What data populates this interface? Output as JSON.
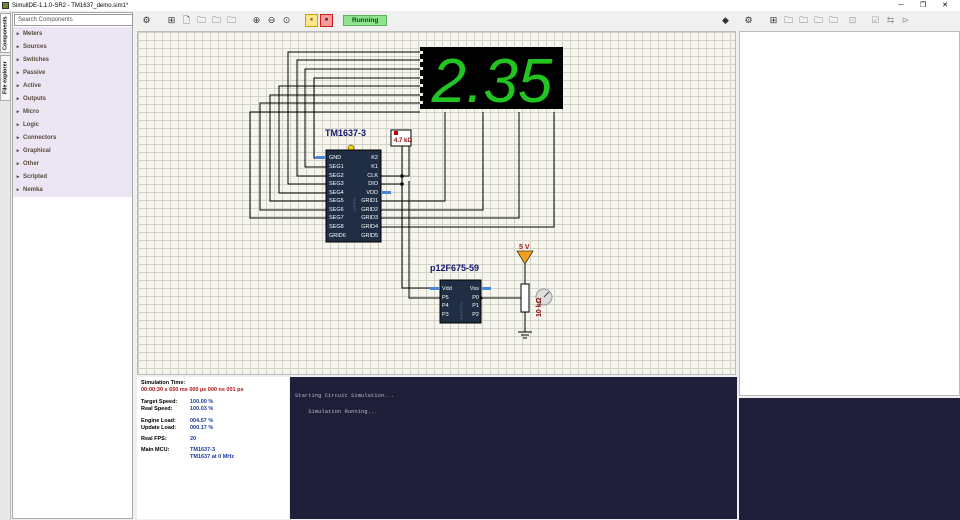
{
  "window": {
    "title": "SimulIDE-1.1.0-SR2 - TM1637_demo.sim1*",
    "minimize": "─",
    "restore": "❐",
    "close": "✕"
  },
  "side_tabs": {
    "components": "Components",
    "file_explorer": "File explorer"
  },
  "components_panel": {
    "search_placeholder": "Search Components",
    "categories": [
      "Meters",
      "Sources",
      "Switches",
      "Passive",
      "Active",
      "Outputs",
      "Micro",
      "Logic",
      "Connectors",
      "Graphical",
      "Other",
      "Scripted",
      "Nemka"
    ]
  },
  "toolbar": {
    "status": "Running"
  },
  "circuit": {
    "display_value": "2.35",
    "tm1637": {
      "label": "TM1637-3",
      "left_pins": [
        "GND",
        "SEG1",
        "SEG2",
        "SEG3",
        "SEG4",
        "SEG5",
        "SEG6",
        "SEG7",
        "SEG8",
        "GRID6"
      ],
      "right_pins": [
        "K2",
        "K1",
        "CLK",
        "DIO",
        "VDD",
        "GRID1",
        "GRID2",
        "GRID3",
        "GRID4",
        "GRID5"
      ],
      "body_text": "TM1637"
    },
    "resistor_label": "4.7 kΩ",
    "mcu": {
      "label": "p12F675-59",
      "left_pins": [
        "Vdd",
        "P5",
        "P4",
        "P3"
      ],
      "right_pins": [
        "Vss",
        "P0",
        "P1",
        "P2"
      ],
      "body_text": "PIC12F675"
    },
    "supply_label": "5 V",
    "pot_label": "10 kΩ"
  },
  "sim_info": {
    "simulation_time_label": "Simulation Time:",
    "simulation_time_value": "00:00:30 s  650 ms  000 µs  000 ns  001 ps",
    "target_speed_label": "Target Speed:",
    "target_speed_value": "100.00 %",
    "real_speed_label": "Real Speed:",
    "real_speed_value": "100.03 %",
    "engine_load_label": "Engine Load:",
    "engine_load_value": "004.57 %",
    "update_load_label": "Update Load:",
    "update_load_value": "000.17 %",
    "real_fps_label": "Real FPS:",
    "real_fps_value": "20",
    "main_mcu_label": "Main MCU:",
    "main_mcu_value1": "TM1637-3",
    "main_mcu_value2": "TM1637 at 0 MHz"
  },
  "console": {
    "line1": "Starting Circuit Simulation...",
    "line2": "    Simulation Running..."
  },
  "icons": [
    "gear-icon",
    "zoom-fit-icon",
    "open-file-icon",
    "save-icon",
    "save-as-icon",
    "print-icon",
    "zoom-in-icon",
    "zoom-out-icon",
    "zoom-reset-icon",
    "pause-icon",
    "stop-icon",
    "info-icon"
  ]
}
